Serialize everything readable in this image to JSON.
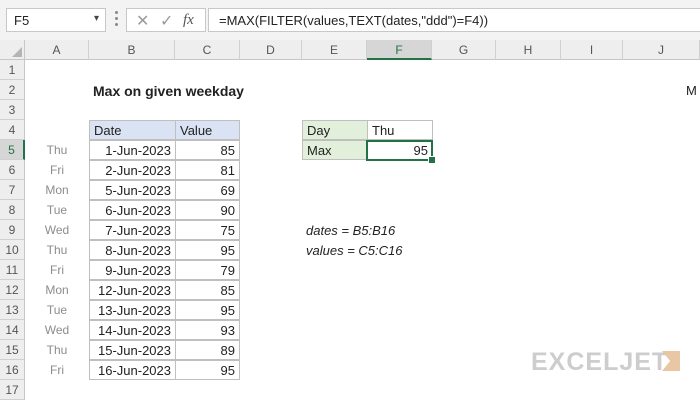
{
  "formula_bar": {
    "name_box": "F5",
    "name_box_arrow": "▾",
    "cancel_glyph": "✕",
    "enter_glyph": "✓",
    "fx_label": "fx",
    "formula": "=MAX(FILTER(values,TEXT(dates,\"ddd\")=F4))"
  },
  "columns": [
    "A",
    "B",
    "C",
    "D",
    "E",
    "F",
    "G",
    "H",
    "I",
    "J"
  ],
  "active_column": "F",
  "rows": [
    "1",
    "2",
    "3",
    "4",
    "5",
    "6",
    "7",
    "8",
    "9",
    "10",
    "11",
    "12",
    "13",
    "14",
    "15",
    "16",
    "17"
  ],
  "active_row": "5",
  "title": "Max on given weekday",
  "clipped_text": "M",
  "table": {
    "headers": [
      "Date",
      "Value"
    ],
    "rows": [
      {
        "weekday": "Thu",
        "date": "1-Jun-2023",
        "value": "85"
      },
      {
        "weekday": "Fri",
        "date": "2-Jun-2023",
        "value": "81"
      },
      {
        "weekday": "Mon",
        "date": "5-Jun-2023",
        "value": "69"
      },
      {
        "weekday": "Tue",
        "date": "6-Jun-2023",
        "value": "90"
      },
      {
        "weekday": "Wed",
        "date": "7-Jun-2023",
        "value": "75"
      },
      {
        "weekday": "Thu",
        "date": "8-Jun-2023",
        "value": "95"
      },
      {
        "weekday": "Fri",
        "date": "9-Jun-2023",
        "value": "79"
      },
      {
        "weekday": "Mon",
        "date": "12-Jun-2023",
        "value": "85"
      },
      {
        "weekday": "Tue",
        "date": "13-Jun-2023",
        "value": "95"
      },
      {
        "weekday": "Wed",
        "date": "14-Jun-2023",
        "value": "93"
      },
      {
        "weekday": "Thu",
        "date": "15-Jun-2023",
        "value": "89"
      },
      {
        "weekday": "Fri",
        "date": "16-Jun-2023",
        "value": "95"
      }
    ]
  },
  "summary": {
    "day_label": "Day",
    "day_value": "Thu",
    "max_label": "Max",
    "max_value": "95"
  },
  "notes": [
    "dates = B5:B16",
    "values = C5:C16"
  ],
  "logo_text": "EXCELJET",
  "colors": {
    "accent": "#217346",
    "header_blue": "#dae3f3",
    "header_green": "#e2efda"
  }
}
